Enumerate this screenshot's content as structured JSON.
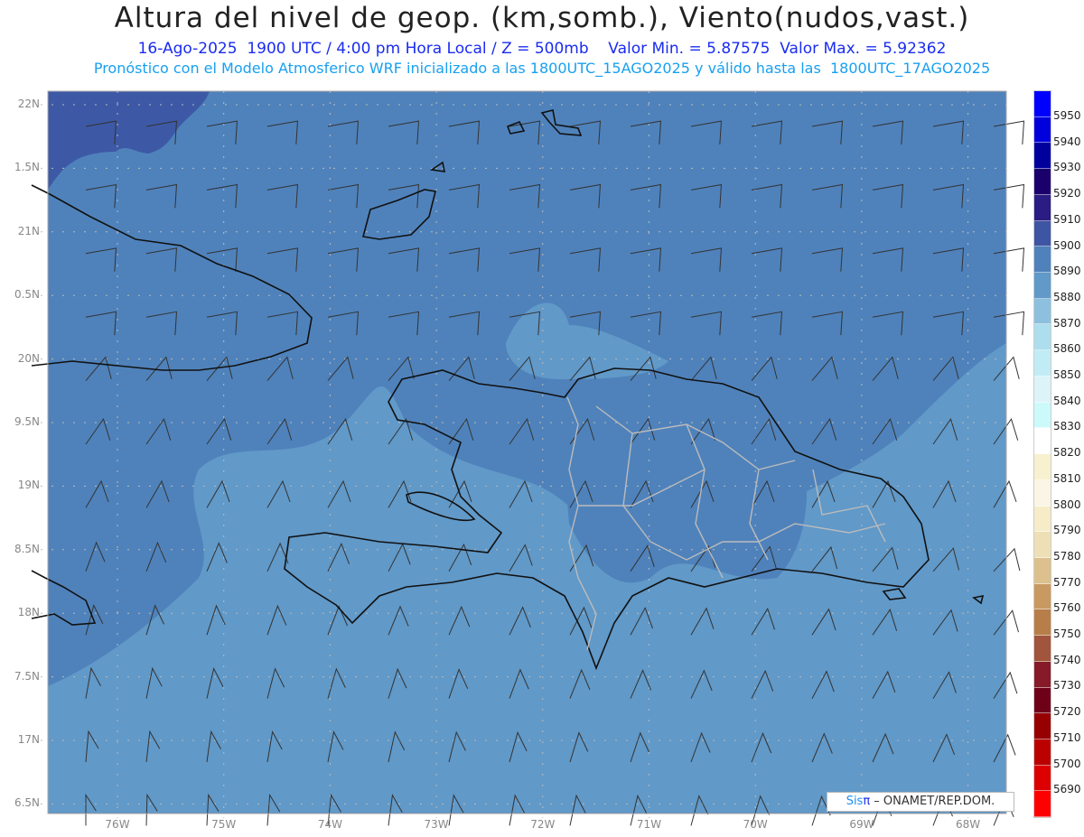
{
  "header": {
    "title": "Altura del nivel de geop. (km,somb.), Viento(nudos,vast.)",
    "subtitle": "16-Ago-2025  1900 UTC / 4:00 pm Hora Local / Z = 500mb    Valor Min. = 5.87575  Valor Max. = 5.92362",
    "model_line": "Pronóstico con el Modelo Atmosferico WRF inicializado a las 1800UTC_15AGO2025 y válido hasta las  1800UTC_17AGO2025"
  },
  "axes": {
    "lat_labels": [
      "22N",
      "1.5N",
      "21N",
      "0.5N",
      "20N",
      "9.5N",
      "19N",
      "8.5N",
      "18N",
      "7.5N",
      "17N",
      "6.5N"
    ],
    "lon_labels": [
      "76W",
      "75W",
      "74W",
      "73W",
      "72W",
      "71W",
      "70W",
      "69W",
      "68W"
    ]
  },
  "colorbar": {
    "labels": [
      "5950",
      "5940",
      "5930",
      "5920",
      "5910",
      "5900",
      "5890",
      "5880",
      "5870",
      "5860",
      "5850",
      "5840",
      "5830",
      "5820",
      "5810",
      "5800",
      "5790",
      "5780",
      "5770",
      "5760",
      "5750",
      "5740",
      "5730",
      "5720",
      "5710",
      "5700",
      "5690"
    ],
    "colors": [
      "#0000ff",
      "#0000dd",
      "#00009c",
      "#1a006a",
      "#2a1c82",
      "#3d55a2",
      "#4f82bb",
      "#6199c8",
      "#8cc0de",
      "#acdeee",
      "#c2ecf5",
      "#dcf4f8",
      "#ccfafb",
      "#ffffff",
      "#f8f1cf",
      "#faf5e5",
      "#f6edc8",
      "#eedfb6",
      "#dcc08e",
      "#c89a62",
      "#b87e4a",
      "#a0553c",
      "#861a28",
      "#6e0018",
      "#960000",
      "#bb0000",
      "#dd0000",
      "#ff0000"
    ]
  },
  "field_colors": {
    "dark": "#3d59a6",
    "mid": "#4f82bb",
    "light": "#6199c8"
  },
  "credit": {
    "logo_text": "Sis",
    "logo_pi": "π",
    "text": " – ONAMET/REP.DOM."
  }
}
